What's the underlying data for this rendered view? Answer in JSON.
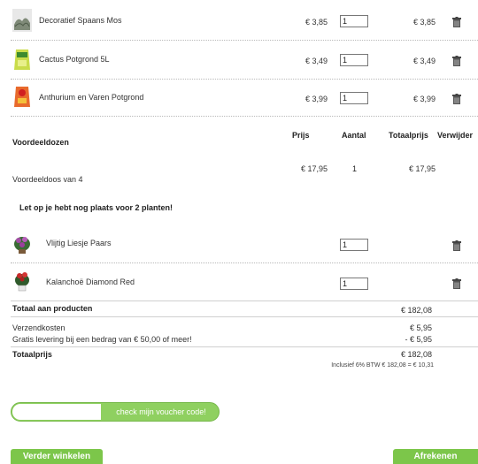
{
  "products": [
    {
      "name": "Decoratief Spaans Mos",
      "price": "€ 3,85",
      "qty": "1",
      "total": "€ 3,85",
      "icon": "moss-thumbnail"
    },
    {
      "name": "Cactus Potgrond 5L",
      "price": "€ 3,49",
      "qty": "1",
      "total": "€ 3,49",
      "icon": "soil-bag-thumbnail"
    },
    {
      "name": "Anthurium en Varen Potgrond",
      "price": "€ 3,99",
      "qty": "1",
      "total": "€ 3,99",
      "icon": "soil-bag-thumbnail"
    }
  ],
  "voordeel": {
    "heading": "Voordeeldozen",
    "col_prijs": "Prijs",
    "col_aantal": "Aantal",
    "col_totaal": "Totaalprijs",
    "col_verwijder": "Verwijder",
    "box_name": "Voordeeldoos van 4",
    "box_price": "€ 17,95",
    "box_qty": "1",
    "box_total": "€ 17,95",
    "notice": "Let op je hebt nog plaats voor 2 planten!",
    "plants": [
      {
        "name": "Vlijtig Liesje Paars",
        "qty": "1"
      },
      {
        "name": "Kalanchoë Diamond Red",
        "qty": "1"
      }
    ]
  },
  "summary": {
    "products_label": "Totaal aan producten",
    "products_value": "€ 182,08",
    "shipping_label": "Verzendkosten",
    "shipping_value": "€ 5,95",
    "free_label": "Gratis levering bij een bedrag van € 50,00 of meer!",
    "free_value": "- € 5,95",
    "total_label": "Totaalprijs",
    "total_value": "€ 182,08",
    "vat_note": "Inclusief 6% BTW € 182,08 = € 10,31"
  },
  "voucher": {
    "input_value": "",
    "button_label": "check mijn voucher code!"
  },
  "buttons": {
    "continue": "Verder winkelen",
    "checkout": "Afrekenen"
  },
  "colors": {
    "accent_green": "#7cc64a"
  }
}
